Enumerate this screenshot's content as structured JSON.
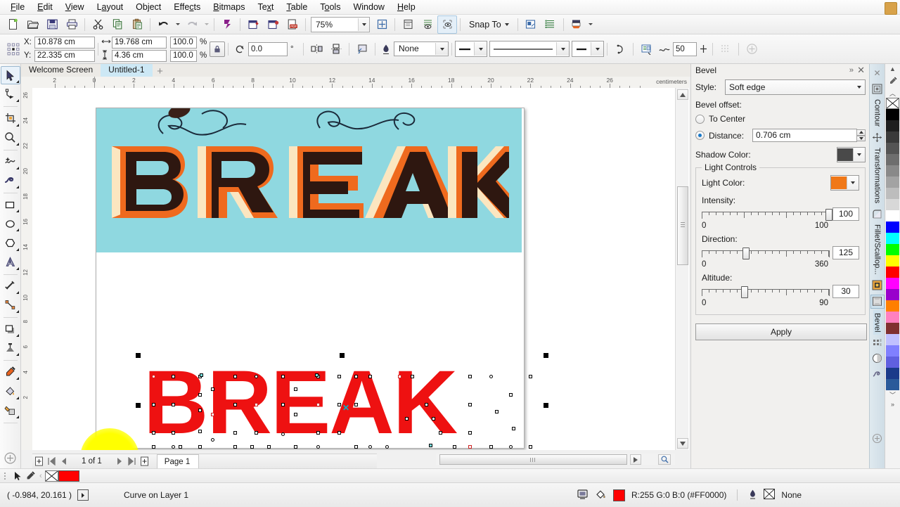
{
  "app": {
    "menu": [
      "File",
      "Edit",
      "View",
      "Layout",
      "Object",
      "Effects",
      "Bitmaps",
      "Text",
      "Table",
      "Tools",
      "Window",
      "Help"
    ]
  },
  "toolbar": {
    "zoom_level": "75%",
    "snap_to_label": "Snap To",
    "icons": [
      "new-document-icon",
      "open-icon",
      "save-icon",
      "print-icon",
      "cut-icon",
      "copy-icon",
      "paste-icon",
      "undo-icon",
      "redo-icon",
      "publish-icon",
      "import-icon",
      "export-icon",
      "export-pdf-icon",
      "zoom-level-combo",
      "full-screen-icon",
      "options-icon",
      "view-icon",
      "snap-icon",
      "application-launcher-icon",
      "object-manager-icon",
      "drop-shadow-icon"
    ]
  },
  "propbar": {
    "x_label": "X:",
    "y_label": "Y:",
    "x_value": "10.878 cm",
    "y_value": "22.335 cm",
    "width_value": "19.768 cm",
    "height_value": "4.36 cm",
    "scale_w": "100.0",
    "scale_h": "100.0",
    "percent": "%",
    "rotation": "0.0",
    "degree": "°",
    "outline_style": "None",
    "outline_width_value": "",
    "wrap_value": "50",
    "lock_ratio": "lock-ratio-icon"
  },
  "tabs": {
    "items": [
      {
        "label": "Welcome Screen",
        "active": false
      },
      {
        "label": "Untitled-1",
        "active": true
      }
    ],
    "plus": "+"
  },
  "rulers": {
    "unit_label": "centimeters",
    "h_ticks": [
      "2",
      "0",
      "2",
      "4",
      "6",
      "8",
      "10",
      "12",
      "14",
      "16",
      "18",
      "20",
      "22",
      "24",
      "26"
    ],
    "v_ticks": [
      "26",
      "24",
      "22",
      "20",
      "18",
      "16",
      "14",
      "12",
      "10",
      "8",
      "6",
      "4",
      "2"
    ]
  },
  "toolbox": {
    "items": [
      {
        "name": "pick-tool",
        "selected": true
      },
      {
        "name": "shape-tool",
        "selected": false
      },
      {
        "name": "crop-tool",
        "selected": false
      },
      {
        "name": "zoom-tool",
        "selected": false
      },
      {
        "name": "freehand-tool",
        "selected": false
      },
      {
        "name": "artistic-media-tool",
        "selected": false
      },
      {
        "name": "rectangle-tool",
        "selected": false
      },
      {
        "name": "ellipse-tool",
        "selected": false
      },
      {
        "name": "polygon-tool",
        "selected": false
      },
      {
        "name": "text-tool",
        "selected": false
      },
      {
        "name": "parallel-dimension-tool",
        "selected": false
      },
      {
        "name": "straight-line-connector-tool",
        "selected": false
      },
      {
        "name": "drop-shadow-tool",
        "selected": false
      },
      {
        "name": "transparency-tool",
        "selected": false
      },
      {
        "name": "color-eyedropper-tool",
        "selected": false
      },
      {
        "name": "interactive-fill-tool",
        "selected": false
      },
      {
        "name": "smart-fill-tool",
        "selected": false
      },
      {
        "name": "quick-customize-tool",
        "selected": false
      }
    ]
  },
  "canvas": {
    "artwork_text": "BREAK",
    "artwork_background": "#8fd8e0",
    "selected_text": "BREAK",
    "selected_color": "#ee1111"
  },
  "pagenav": {
    "page_of": "1 of 1",
    "page_tab": "Page 1",
    "add_page_before_icon": "add-page-before-icon",
    "first_icon": "first-page-icon",
    "prev_icon": "previous-page-icon",
    "next_icon": "next-page-icon",
    "last_icon": "last-page-icon",
    "add_page_after_icon": "add-page-after-icon"
  },
  "statusbar": {
    "coordinates": "( -0.984, 20.161 )",
    "object_info": "Curve on Layer 1",
    "fill_text": "R:255 G:0 B:0 (#FF0000)",
    "fill_color": "#FF0000",
    "outline_text": "None"
  },
  "docker": {
    "title": "Bevel",
    "style_label": "Style:",
    "style_value": "Soft edge",
    "bevel_offset_label": "Bevel offset:",
    "to_center_label": "To Center",
    "to_center_selected": false,
    "distance_label": "Distance:",
    "distance_selected": true,
    "distance_value": "0.706 cm",
    "shadow_color_label": "Shadow Color:",
    "shadow_color": "#494949",
    "light_controls_label": "Light Controls",
    "light_color_label": "Light Color:",
    "light_color": "#f07818",
    "intensity_label": "Intensity:",
    "intensity_value": "100",
    "intensity_min": "0",
    "intensity_max": "100",
    "direction_label": "Direction:",
    "direction_value": "125",
    "direction_min": "0",
    "direction_max": "360",
    "altitude_label": "Altitude:",
    "altitude_value": "30",
    "altitude_min": "0",
    "altitude_max": "90",
    "apply_label": "Apply"
  },
  "docker_strip": {
    "labels": [
      "Contour",
      "Transformations",
      "Fillet/Scallop...",
      "Bevel"
    ]
  },
  "palette": {
    "none_label": "None",
    "colors": [
      "#000000",
      "#1f1f1f",
      "#3a3a3a",
      "#545454",
      "#6e6e6e",
      "#898989",
      "#a3a3a3",
      "#bdbdbd",
      "#d8d8d8",
      "#ffffff",
      "#0000ff",
      "#00ffff",
      "#00ff00",
      "#ffff00",
      "#ff0000",
      "#ff00ff",
      "#9900cc",
      "#ff7f00",
      "#ff80c0",
      "#803030",
      "#c0c0ff",
      "#8080ff",
      "#6060e0",
      "#1a3a8a",
      "#2a5a9a"
    ]
  }
}
